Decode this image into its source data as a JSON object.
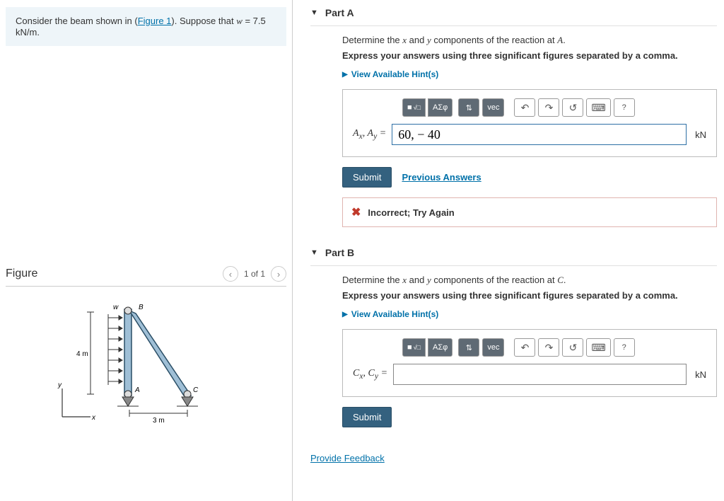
{
  "problem": {
    "pre_text": "Consider the beam shown in (",
    "figure_link": "Figure 1",
    "post_text": "). Suppose that ",
    "var": "w",
    "equals": " = 7.5 kN/m."
  },
  "figure": {
    "title": "Figure",
    "nav": "1 of 1",
    "labels": {
      "w": "w",
      "B": "B",
      "A": "A",
      "C": "C",
      "h": "4 m",
      "l": "3 m",
      "x": "x",
      "y": "y"
    }
  },
  "partA": {
    "title": "Part A",
    "prompt_pre": "Determine the ",
    "prompt_x": "x",
    "prompt_mid": " and ",
    "prompt_y": "y",
    "prompt_post": " components of the reaction at ",
    "prompt_pt": "A",
    "prompt_end": ".",
    "instruction": "Express your answers using three significant figures separated by a comma.",
    "hints": "View Available Hint(s)",
    "toolbar": {
      "tmpl": "□",
      "rad": "√□",
      "greek": "ΑΣφ",
      "arrows": "⇅",
      "vec": "vec",
      "undo": "↶",
      "redo": "↷",
      "reset": "↺",
      "kbd": "⌨",
      "help": "?"
    },
    "lhs": "Aₓ, Aᵧ = ",
    "value": "60, − 40",
    "unit": "kN",
    "submit": "Submit",
    "previous": "Previous Answers",
    "feedback": "Incorrect; Try Again"
  },
  "partB": {
    "title": "Part B",
    "prompt_pre": "Determine the ",
    "prompt_x": "x",
    "prompt_mid": " and ",
    "prompt_y": "y",
    "prompt_post": " components of the reaction at ",
    "prompt_pt": "C",
    "prompt_end": ".",
    "instruction": "Express your answers using three significant figures separated by a comma.",
    "hints": "View Available Hint(s)",
    "toolbar": {
      "tmpl": "□",
      "rad": "√□",
      "greek": "ΑΣφ",
      "arrows": "⇅",
      "vec": "vec",
      "undo": "↶",
      "redo": "↷",
      "reset": "↺",
      "kbd": "⌨",
      "help": "?"
    },
    "lhs": "Cₓ, Cᵧ = ",
    "value": "",
    "unit": "kN",
    "submit": "Submit"
  },
  "feedback_link": "Provide Feedback"
}
